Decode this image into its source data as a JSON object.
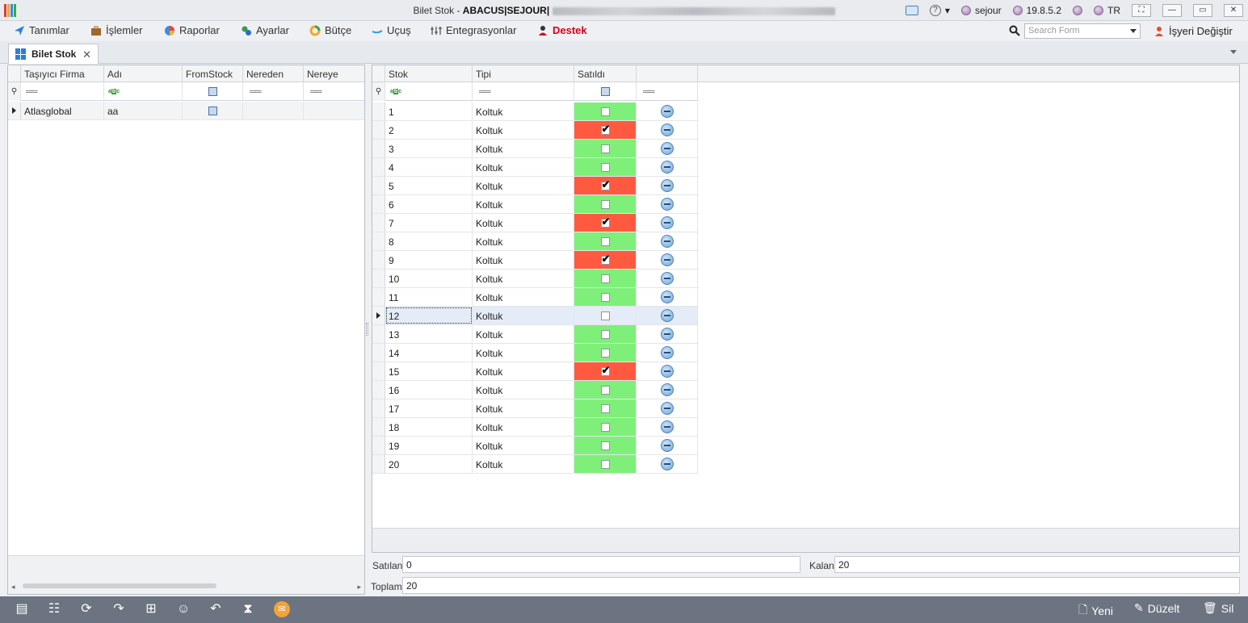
{
  "window": {
    "title_prefix": "Bilet Stok - ",
    "title_bold": "ABACUS|SEJOUR|",
    "user": "sejour",
    "version": "19.8.5.2",
    "language": "TR"
  },
  "menu": {
    "items": [
      "Tanımlar",
      "İşlemler",
      "Raporlar",
      "Ayarlar",
      "Bütçe",
      "Uçuş",
      "Entegrasyonlar",
      "Destek"
    ],
    "search_placeholder": "Search Form",
    "workplace_label": "İşyeri Değiştir"
  },
  "tab": {
    "label": "Bilet Stok"
  },
  "left_grid": {
    "columns": [
      "Taşıyıcı Firma",
      "Adı",
      "FromStock",
      "Nereden",
      "Nereye"
    ],
    "rows": [
      {
        "firma": "Atlasglobal",
        "adi": "aa",
        "from_stock": false,
        "nereden": "",
        "nereye": ""
      }
    ]
  },
  "right_grid": {
    "columns": [
      "Stok",
      "Tipi",
      "Satıldı",
      ""
    ],
    "selected_row_index": 11,
    "rows": [
      {
        "stok": "1",
        "tipi": "Koltuk",
        "satildi": false
      },
      {
        "stok": "2",
        "tipi": "Koltuk",
        "satildi": true
      },
      {
        "stok": "3",
        "tipi": "Koltuk",
        "satildi": false
      },
      {
        "stok": "4",
        "tipi": "Koltuk",
        "satildi": false
      },
      {
        "stok": "5",
        "tipi": "Koltuk",
        "satildi": true
      },
      {
        "stok": "6",
        "tipi": "Koltuk",
        "satildi": false
      },
      {
        "stok": "7",
        "tipi": "Koltuk",
        "satildi": true
      },
      {
        "stok": "8",
        "tipi": "Koltuk",
        "satildi": false
      },
      {
        "stok": "9",
        "tipi": "Koltuk",
        "satildi": true
      },
      {
        "stok": "10",
        "tipi": "Koltuk",
        "satildi": false
      },
      {
        "stok": "11",
        "tipi": "Koltuk",
        "satildi": false
      },
      {
        "stok": "12",
        "tipi": "Koltuk",
        "satildi": false
      },
      {
        "stok": "13",
        "tipi": "Koltuk",
        "satildi": false
      },
      {
        "stok": "14",
        "tipi": "Koltuk",
        "satildi": false
      },
      {
        "stok": "15",
        "tipi": "Koltuk",
        "satildi": true
      },
      {
        "stok": "16",
        "tipi": "Koltuk",
        "satildi": false
      },
      {
        "stok": "17",
        "tipi": "Koltuk",
        "satildi": false
      },
      {
        "stok": "18",
        "tipi": "Koltuk",
        "satildi": false
      },
      {
        "stok": "19",
        "tipi": "Koltuk",
        "satildi": false
      },
      {
        "stok": "20",
        "tipi": "Koltuk",
        "satildi": false
      }
    ]
  },
  "totals": {
    "satilan_label": "Satılan",
    "satilan_value": "0",
    "kalan_label": "Kalan",
    "kalan_value": "20",
    "toplam_label": "Toplam",
    "toplam_value": "20"
  },
  "toolbar": {
    "yeni_label": "Yeni",
    "duzelt_label": "Düzelt",
    "sil_label": "Sil"
  },
  "colors": {
    "sold": "#ff5a40",
    "available": "#7ef07a",
    "selected_row": "#e4ecf8",
    "toolbar_bg": "#6b7480",
    "destek": "#d6001c"
  }
}
